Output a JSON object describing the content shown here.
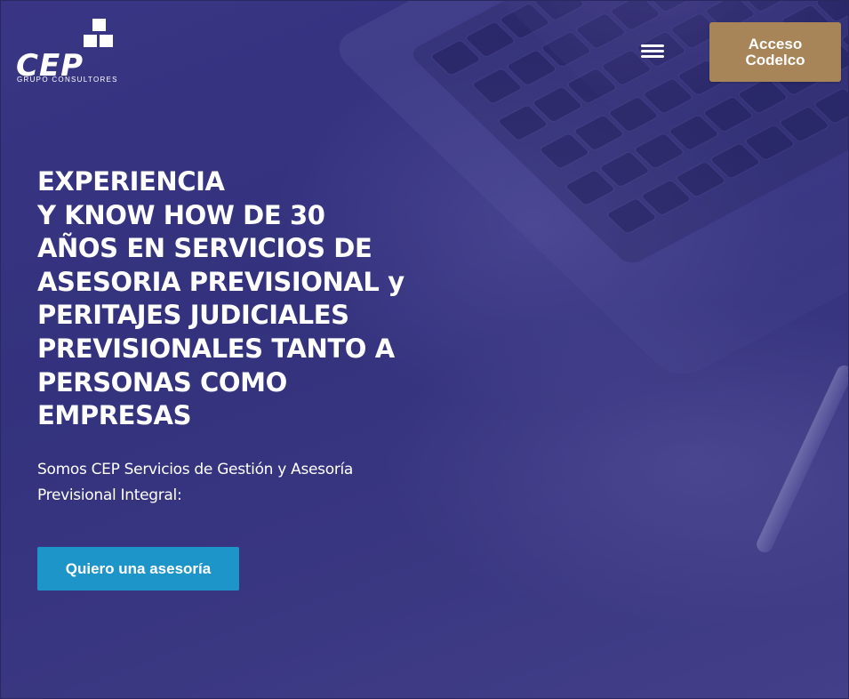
{
  "header": {
    "logo": {
      "name": "CEP",
      "subtitle": "GRUPO CONSULTORES",
      "icon": "stacked-blocks-logo-icon"
    },
    "menu_icon": "hamburger-menu-icon",
    "access_button": "Acceso\nCodelco"
  },
  "hero": {
    "headline_lines": [
      "EXPERIENCIA",
      "Y KNOW HOW DE 30",
      "AÑOS EN SERVICIOS DE",
      "ASESORIA PREVISIONAL y",
      "PERITAJES JUDICIALES",
      "PREVISIONALES TANTO A",
      "PERSONAS COMO",
      "EMPRESAS"
    ],
    "subtitle_lines": [
      "Somos CEP Servicios de Gestión y Asesoría",
      "Previsional Integral:"
    ],
    "cta_label": "Quiero una asesoría"
  },
  "colors": {
    "background_overlay": "#3d3a8a",
    "access_button": "#a88558",
    "cta_button": "#1e95c8",
    "text": "#ffffff"
  }
}
